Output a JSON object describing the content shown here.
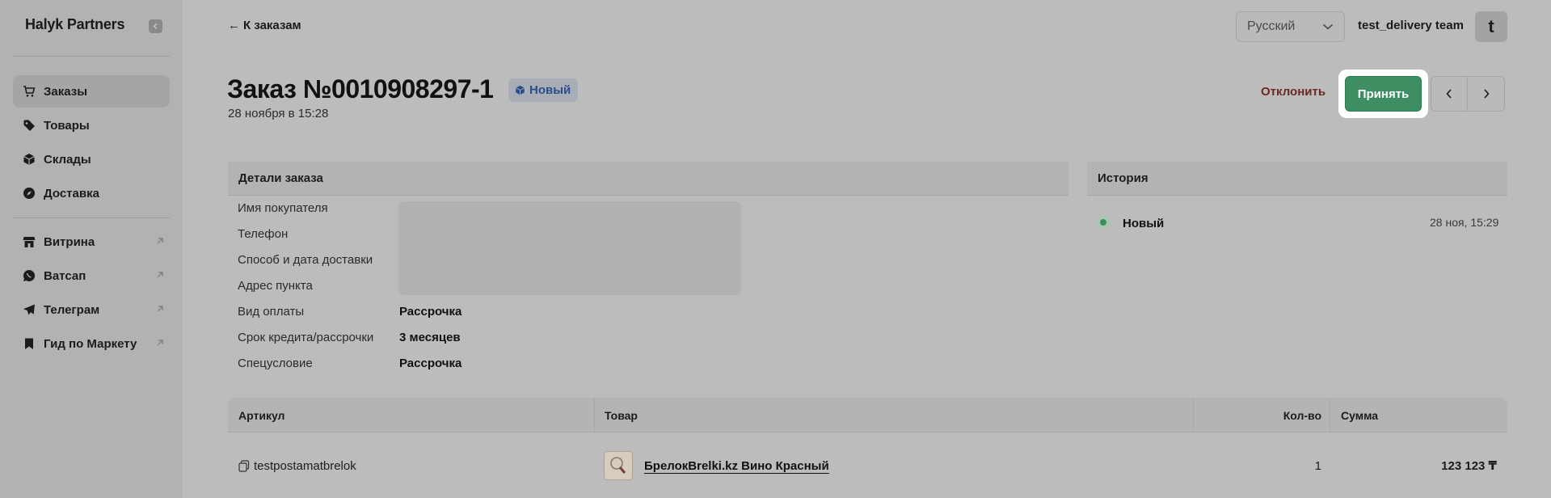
{
  "sidebar": {
    "brand": "Halyk Partners",
    "items": [
      {
        "label": "Заказы",
        "icon": "cart-icon",
        "active": true
      },
      {
        "label": "Товары",
        "icon": "tag-icon"
      },
      {
        "label": "Склады",
        "icon": "box-icon"
      },
      {
        "label": "Доставка",
        "icon": "compass-icon"
      }
    ],
    "external_items": [
      {
        "label": "Витрина",
        "icon": "storefront-icon"
      },
      {
        "label": "Ватсап",
        "icon": "whatsapp-icon"
      },
      {
        "label": "Телеграм",
        "icon": "telegram-icon"
      },
      {
        "label": "Гид по Маркету",
        "icon": "bookmark-icon"
      }
    ]
  },
  "header": {
    "back_label": "К заказам",
    "language": "Русский",
    "team": "test_delivery team",
    "avatar_letter": "t"
  },
  "order": {
    "title": "Заказ №0010908297-1",
    "status": "Новый",
    "date": "28 ноября в 15:28",
    "reject_label": "Отклонить",
    "accept_label": "Принять"
  },
  "details": {
    "heading": "Детали заказа",
    "labels": [
      "Имя покупателя",
      "Телефон",
      "Способ и дата доставки",
      "Адрес пункта",
      "Вид оплаты",
      "Срок кредита/рассрочки",
      "Спецусловие"
    ],
    "payment_type": "Рассрочка",
    "credit_term": "3 месяцев",
    "special_condition": "Рассрочка"
  },
  "history": {
    "heading": "История",
    "status": "Новый",
    "time": "28 ноя, 15:29"
  },
  "table": {
    "headers": {
      "sku": "Артикул",
      "product": "Товар",
      "qty": "Кол-во",
      "sum": "Сумма"
    },
    "rows": [
      {
        "sku": "testpostamatbrelok",
        "product": "БрелокBrelki.kz Вино Красный",
        "qty": "1",
        "sum": "123 123 ₸"
      }
    ]
  },
  "colors": {
    "accent_green": "#3d8f63",
    "reject_red": "#6b2a22",
    "badge_blue": "#2a4c8a"
  }
}
